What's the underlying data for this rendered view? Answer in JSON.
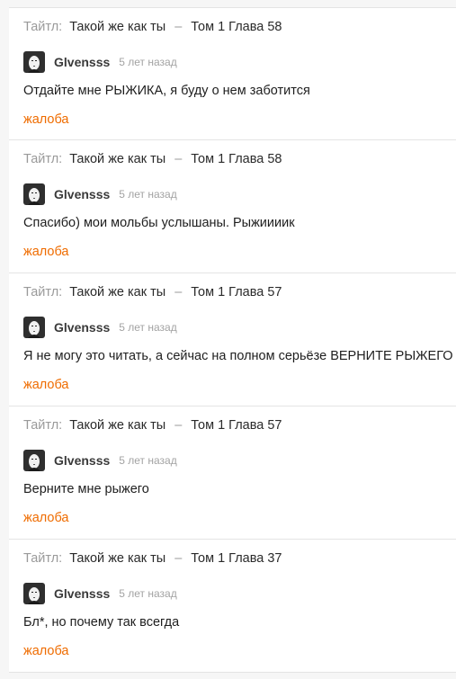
{
  "comments": [
    {
      "title_label": "Тайтл:",
      "manga": "Такой же как ты",
      "separator": "–",
      "chapter": "Том 1 Глава 58",
      "author": "Glvensss",
      "time": "5 лет назад",
      "text": "Отдайте мне РЫЖИКА, я буду о нем заботится",
      "report_label": "жалоба"
    },
    {
      "title_label": "Тайтл:",
      "manga": "Такой же как ты",
      "separator": "–",
      "chapter": "Том 1 Глава 58",
      "author": "Glvensss",
      "time": "5 лет назад",
      "text": "Спасибо) мои мольбы услышаны. Рыжиииик",
      "report_label": "жалоба"
    },
    {
      "title_label": "Тайтл:",
      "manga": "Такой же как ты",
      "separator": "–",
      "chapter": "Том 1 Глава 57",
      "author": "Glvensss",
      "time": "5 лет назад",
      "text": "Я не могу это читать, а сейчас на полном серьёзе ВЕРНИТЕ РЫЖЕГО",
      "report_label": "жалоба"
    },
    {
      "title_label": "Тайтл:",
      "manga": "Такой же как ты",
      "separator": "–",
      "chapter": "Том 1 Глава 57",
      "author": "Glvensss",
      "time": "5 лет назад",
      "text": "Верните мне рыжего",
      "report_label": "жалоба"
    },
    {
      "title_label": "Тайтл:",
      "manga": "Такой же как ты",
      "separator": "–",
      "chapter": "Том 1 Глава 37",
      "author": "Glvensss",
      "time": "5 лет назад",
      "text": "Бл*, но почему так всегда",
      "report_label": "жалоба"
    }
  ],
  "colors": {
    "report": "#ef6c00",
    "label_gray": "#9a9a9a",
    "divider": "#e4e4e4"
  },
  "icons": {
    "avatar": "no-face-avatar-icon"
  }
}
